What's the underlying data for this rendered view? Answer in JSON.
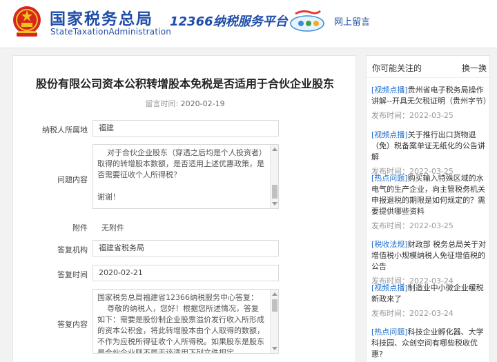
{
  "header": {
    "logo_cn": "国家税务总局",
    "logo_en": "StateTaxationAdministration",
    "platform": "12366纳税服务平台",
    "online_message": "网上留言"
  },
  "article": {
    "title": "股份有限公司资本公积转增股本免税是否适用于合伙企业股东",
    "reply_date_label": "留言时间:",
    "reply_date": "2020-02-19",
    "fields": {
      "location_label": "纳税人所属地",
      "location_value": "福建",
      "question_label": "问题内容",
      "question_value": "    对于合伙企业股东（穿透之后均是个人投资者）取得的转增股本数额，是否适用上述优惠政策，是否需要征收个人所得税？\n\n谢谢！",
      "attachment_label": "附件",
      "attachment_value": "无附件",
      "agency_label": "答复机构",
      "agency_value": "福建省税务局",
      "answer_time_label": "答复时间",
      "answer_time_value": "2020-02-21",
      "answer_label": "答复内容",
      "answer_value": "国家税务总局福建省12366纳税服务中心答复：\n    尊敬的纳税人，您好！根据您所述情况，答复如下：需要是股份制企业股票溢价发行收入所形成的资本公积金，将此转增股本由个人取得的数额，不作为应税所得征收个人所得税。如果股东是股东是合伙企业则不属于该适用下列文件规定。\n    文件依据"
    }
  },
  "sidebar": {
    "title": "你可能关注的",
    "switch_label": "换一换",
    "date_label": "发布时间：",
    "items": [
      {
        "tag": "[视频点播]",
        "text": "贵州省电子税务局操作讲解--开具无欠税证明（贵州字节）",
        "date": "2022-03-25"
      },
      {
        "tag": "[视频点播]",
        "text": "关于推行出口货物退（免）税备案单证无纸化的公告讲解",
        "date": "2022-03-25"
      },
      {
        "tag": "[热点问题]",
        "text": "购买输入特殊区域的水电气的生产企业，向主管税务机关申报退税的期限是如何规定的？需要提供哪些资料",
        "date": "2022-03-25"
      },
      {
        "tag": "[税收法规]",
        "text": "财政部 税务总局关于对增值税小规模纳税人免征增值税的公告",
        "date": "2022-03-24"
      },
      {
        "tag": "[视频点播]",
        "text": "制造业中小微企业缓税新政来了",
        "date": "2022-03-24"
      },
      {
        "tag": "[热点问题]",
        "text": "科技企业孵化器、大学科技园、众创空间有哪些税收优惠?",
        "date": "2022-03-24"
      }
    ]
  },
  "colors": {
    "brand_blue": "#1f4ea8",
    "link_blue": "#1f6fd0",
    "emblem_red": "#d7261e"
  }
}
